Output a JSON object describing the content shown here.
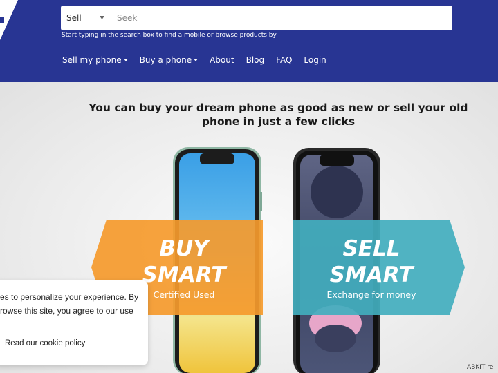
{
  "header": {
    "search": {
      "category": "Sell",
      "placeholder": "Seek",
      "hint": "Start typing in the search box to find a mobile or browse products by"
    },
    "nav": [
      {
        "label": "Sell my phone"
      },
      {
        "label": "Buy a phone"
      },
      {
        "label": "About"
      },
      {
        "label": "Blog"
      },
      {
        "label": "FAQ"
      },
      {
        "label": "Login"
      }
    ]
  },
  "hero": {
    "headline": "You can buy your dream phone as good as new or sell your old phone in just a few clicks",
    "buy": {
      "title_line1": "BUY",
      "title_line2": "SMART",
      "subtitle": "Certified Used"
    },
    "sell": {
      "title_line1": "SELL",
      "title_line2": "SMART",
      "subtitle": "Exchange for money"
    }
  },
  "cookie": {
    "line1": "es to personalize your experience. By",
    "line2": "rowse this site, you agree to our use",
    "link": "Read our cookie policy"
  },
  "footer_peek": "ABKIT re",
  "colors": {
    "header_bg": "#283593",
    "buy_accent": "#f59a2d",
    "sell_accent": "#42aebe",
    "link_white": "#ffffff"
  },
  "icons": [
    "logo-mark",
    "chevron-down-icon",
    "dropdown-caret-icon"
  ]
}
